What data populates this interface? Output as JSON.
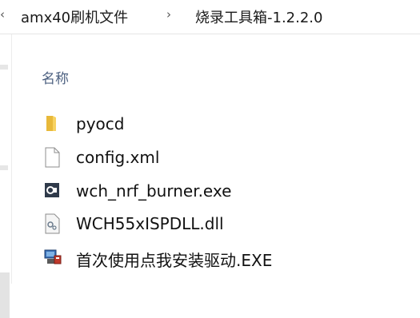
{
  "breadcrumb": {
    "arrow": "‹",
    "separator": "›",
    "items": [
      "amx40刷机文件",
      "烧录工具箱-1.2.2.0"
    ]
  },
  "file_list": {
    "column_header": "名称",
    "files": [
      {
        "name": "pyocd",
        "icon": "folder-icon"
      },
      {
        "name": "config.xml",
        "icon": "document-icon"
      },
      {
        "name": "wch_nrf_burner.exe",
        "icon": "app-icon"
      },
      {
        "name": "WCH55xISPDLL.dll",
        "icon": "dll-icon"
      },
      {
        "name": "首次使用点我安装驱动.EXE",
        "icon": "installer-icon"
      }
    ]
  }
}
